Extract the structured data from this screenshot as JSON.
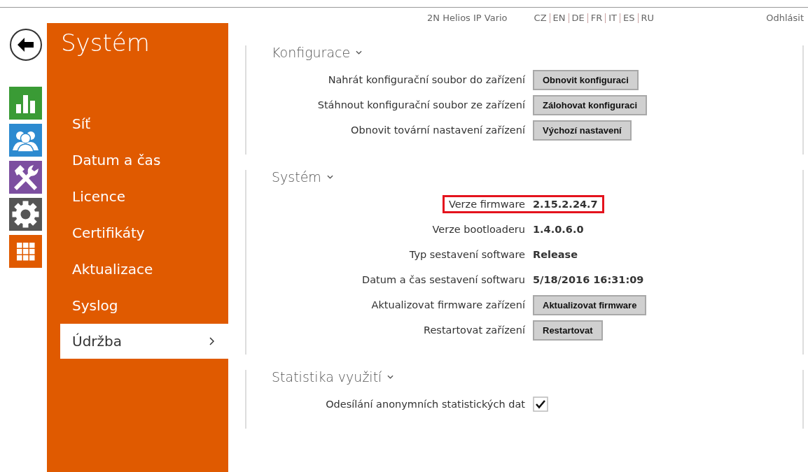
{
  "header": {
    "device": "2N Helios IP Vario",
    "languages": [
      "CZ",
      "EN",
      "DE",
      "FR",
      "IT",
      "ES",
      "RU"
    ],
    "logout": "Odhlásit"
  },
  "nav_icons": [
    {
      "kind": "back"
    },
    {
      "kind": "chart",
      "color": "#3a9b35"
    },
    {
      "kind": "users",
      "color": "#2c8ad0"
    },
    {
      "kind": "tools",
      "color": "#7c4fa0"
    },
    {
      "kind": "gear",
      "color": "#555555"
    },
    {
      "kind": "grid",
      "color": "#e05a00"
    }
  ],
  "sidebar": {
    "title": "Systém",
    "items": [
      {
        "label": "Síť",
        "selected": false
      },
      {
        "label": "Datum a čas",
        "selected": false
      },
      {
        "label": "Licence",
        "selected": false
      },
      {
        "label": "Certifikáty",
        "selected": false
      },
      {
        "label": "Aktualizace",
        "selected": false
      },
      {
        "label": "Syslog",
        "selected": false
      },
      {
        "label": "Údržba",
        "selected": true
      }
    ]
  },
  "sections": [
    {
      "title": "Konfigurace",
      "rows": [
        {
          "kind": "button",
          "label": "Nahrát konfigurační soubor do zařízení",
          "value": "Obnovit konfiguraci"
        },
        {
          "kind": "button",
          "label": "Stáhnout konfigurační soubor ze zařízení",
          "value": "Zálohovat konfiguraci"
        },
        {
          "kind": "button",
          "label": "Obnovit tovární nastavení zařízení",
          "value": "Výchozí nastavení"
        }
      ]
    },
    {
      "title": "Systém",
      "rows": [
        {
          "kind": "value",
          "label": "Verze firmware",
          "value": "2.15.2.24.7",
          "highlighted": true
        },
        {
          "kind": "value",
          "label": "Verze bootloaderu",
          "value": "1.4.0.6.0",
          "highlighted": false
        },
        {
          "kind": "value",
          "label": "Typ sestavení software",
          "value": "Release",
          "highlighted": false
        },
        {
          "kind": "value",
          "label": "Datum a čas sestavení softwaru",
          "value": "5/18/2016 16:31:09",
          "highlighted": false
        },
        {
          "kind": "button",
          "label": "Aktualizovat firmware zařízení",
          "value": "Aktualizovat firmware"
        },
        {
          "kind": "button",
          "label": "Restartovat zařízení",
          "value": "Restartovat"
        }
      ]
    },
    {
      "title": "Statistika využití",
      "rows": [
        {
          "kind": "checkbox",
          "label": "Odesílání anonymních statistických dat",
          "checked": true
        }
      ]
    }
  ]
}
